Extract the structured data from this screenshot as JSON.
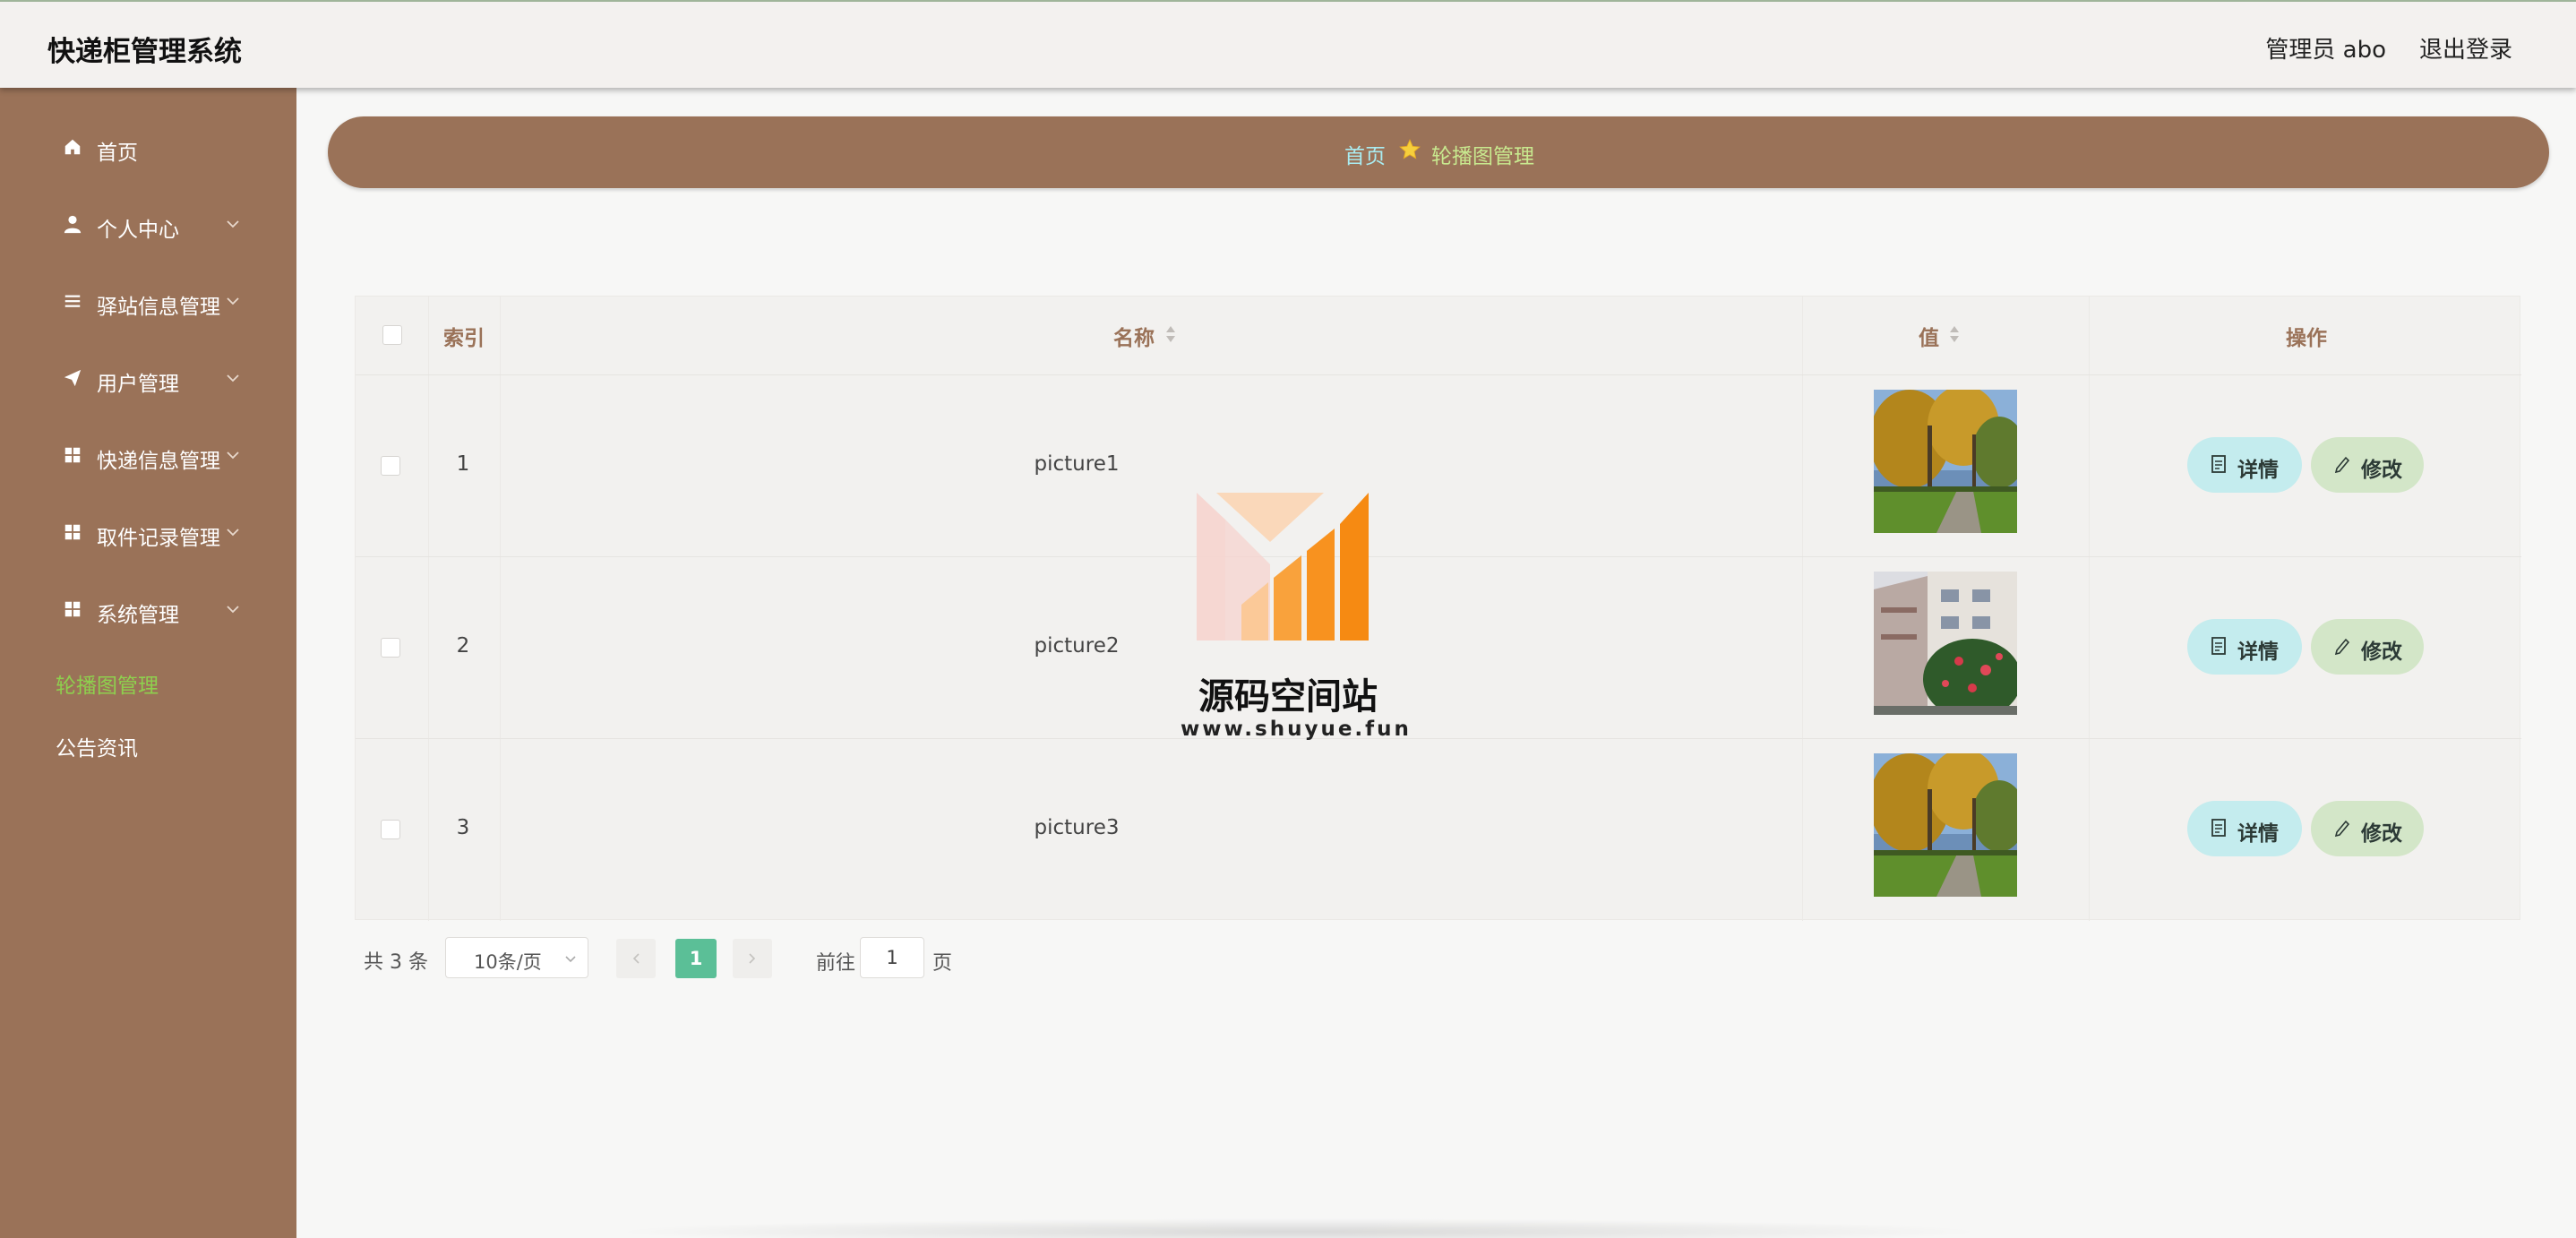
{
  "header": {
    "app_title": "快递柜管理系统",
    "admin_label": "管理员 abo",
    "logout_label": "退出登录"
  },
  "sidebar": {
    "items": [
      {
        "label": "首页",
        "icon": "home-icon"
      },
      {
        "label": "个人中心",
        "icon": "user-icon"
      },
      {
        "label": "驿站信息管理",
        "icon": "list-icon"
      },
      {
        "label": "用户管理",
        "icon": "send-icon"
      },
      {
        "label": "快递信息管理",
        "icon": "grid-icon"
      },
      {
        "label": "取件记录管理",
        "icon": "grid-icon"
      },
      {
        "label": "系统管理",
        "icon": "grid-icon"
      }
    ],
    "sub_items": [
      {
        "label": "轮播图管理",
        "active": true
      },
      {
        "label": "公告资讯",
        "active": false
      }
    ]
  },
  "breadcrumb": {
    "home": "首页",
    "current": "轮播图管理"
  },
  "table": {
    "columns": [
      "索引",
      "名称",
      "值",
      "操作"
    ],
    "rows": [
      {
        "index": "1",
        "name": "picture1",
        "image": "autumn-campus-trees"
      },
      {
        "index": "2",
        "name": "picture2",
        "image": "building-with-red-flowers"
      },
      {
        "index": "3",
        "name": "picture3",
        "image": "autumn-campus-trees"
      }
    ],
    "detail_label": "详情",
    "edit_label": "修改"
  },
  "pagination": {
    "total_text": "共 3 条",
    "page_size": "10条/页",
    "current_page": "1",
    "goto_label": "前往",
    "goto_value": "1",
    "goto_suffix": "页"
  },
  "watermark": {
    "title": "源码空间站",
    "url": "www.shuyue.fun"
  },
  "colors": {
    "sidebar": "#9a7258",
    "accent_green": "#5bbf97",
    "active_menu": "#8ed04e",
    "breadcrumb_home": "#a9ecf1",
    "breadcrumb_current": "#c8e98f"
  }
}
